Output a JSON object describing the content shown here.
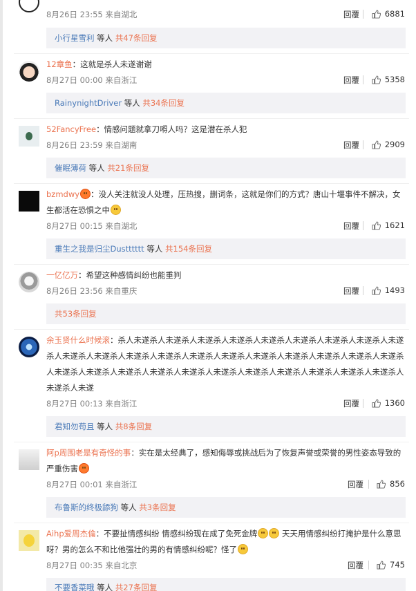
{
  "comments": [
    {
      "user": "",
      "text": "",
      "time": "8月26日 23:55",
      "location": "来自湖北",
      "reply_label": "回覆",
      "likes": "6881",
      "sub": {
        "prefix": "小行星雪利",
        "mid": "等人",
        "count": "共47条回复"
      }
    },
    {
      "user": "12章鱼",
      "text": "这就是杀人未遂谢谢",
      "time": "8月27日 00:00",
      "location": "来自浙江",
      "reply_label": "回覆",
      "likes": "5358",
      "sub": {
        "prefix": "RainynightDriver",
        "mid": "等人",
        "count": "共34条回复"
      }
    },
    {
      "user": "52FancyFree",
      "text": "情感问题就拿刀嘚人吗？这是潜在杀人犯",
      "time": "8月26日 23:59",
      "location": "来自湖南",
      "reply_label": "回覆",
      "likes": "2909",
      "sub": {
        "prefix": "催眠薄荷",
        "mid": "等人",
        "count": "共21条回复"
      }
    },
    {
      "user": "bzmdwy",
      "text": "没人关注就没人处理，压热搜，删词条，这就是你们的方式？唐山十堰事件不解决，女生都活在恐惧之中",
      "time": "8月27日 00:15",
      "location": "来自湖北",
      "reply_label": "回覆",
      "likes": "1621",
      "sub": {
        "prefix": "重生之我是归尘Dustttttt",
        "mid": "等人",
        "count": "共154条回复"
      }
    },
    {
      "user": "一亿亿万",
      "text": "希望这种感情纠纷也能重判",
      "time": "8月26日 23:56",
      "location": "来自重庆",
      "reply_label": "回覆",
      "likes": "1493",
      "sub": {
        "prefix": "",
        "mid": "",
        "count": "共53条回复"
      }
    },
    {
      "user": "余玉贤什么时候滚",
      "text": "杀人未遂杀人未遂杀人未遂杀人未遂杀人未遂杀人未遂杀人未遂杀人未遂杀人未遂杀人未遂杀人未遂杀人未遂杀人未遂杀人未遂杀人未遂杀人未遂杀人未遂杀人未遂杀人未遂杀人未遂杀人未遂杀人未遂杀人未遂杀人未遂杀人未遂杀人未遂杀人未遂杀人未遂杀人未遂杀人未遂杀人未遂杀人未遂杀人未遂",
      "time": "8月27日 00:13",
      "location": "来自浙江",
      "reply_label": "回覆",
      "likes": "1360",
      "sub": {
        "prefix": "君知勿苟且",
        "mid": "等人",
        "count": "共8条回复"
      }
    },
    {
      "user": "阿p周围老是有奇怪的事",
      "text": "实在是太经典了，感知侮辱或挑战后为了恢复声誉或荣誉的男性姿态导致的严重伤害",
      "time": "8月27日 00:01",
      "location": "来自浙江",
      "reply_label": "回覆",
      "likes": "856",
      "sub": {
        "prefix": "布鲁斯的终极舔狗",
        "mid": "等人",
        "count": "共3条回复"
      }
    },
    {
      "user": "Aihp爱周杰倫",
      "text_a": "不要扯情感纠纷 情感纠纷现在成了免死金牌",
      "text_b": "天天用情感纠纷打掩护是什么意思呀？男的怎么不和比他强壮的男的有情感纠纷呢？怪了",
      "time": "8月27日 00:35",
      "location": "来自北京",
      "reply_label": "回覆",
      "likes": "745",
      "sub": {
        "prefix": "不要香菜哦",
        "mid": "等人",
        "count": "共27条回复"
      }
    }
  ],
  "icons": {
    "like": "thumbs-up-icon",
    "emoji": "smile-emoji-icon"
  },
  "colors": {
    "username": "#eb7350",
    "link": "#4a7ab8",
    "meta": "#808080",
    "sub_bg": "#f2f2f5"
  }
}
